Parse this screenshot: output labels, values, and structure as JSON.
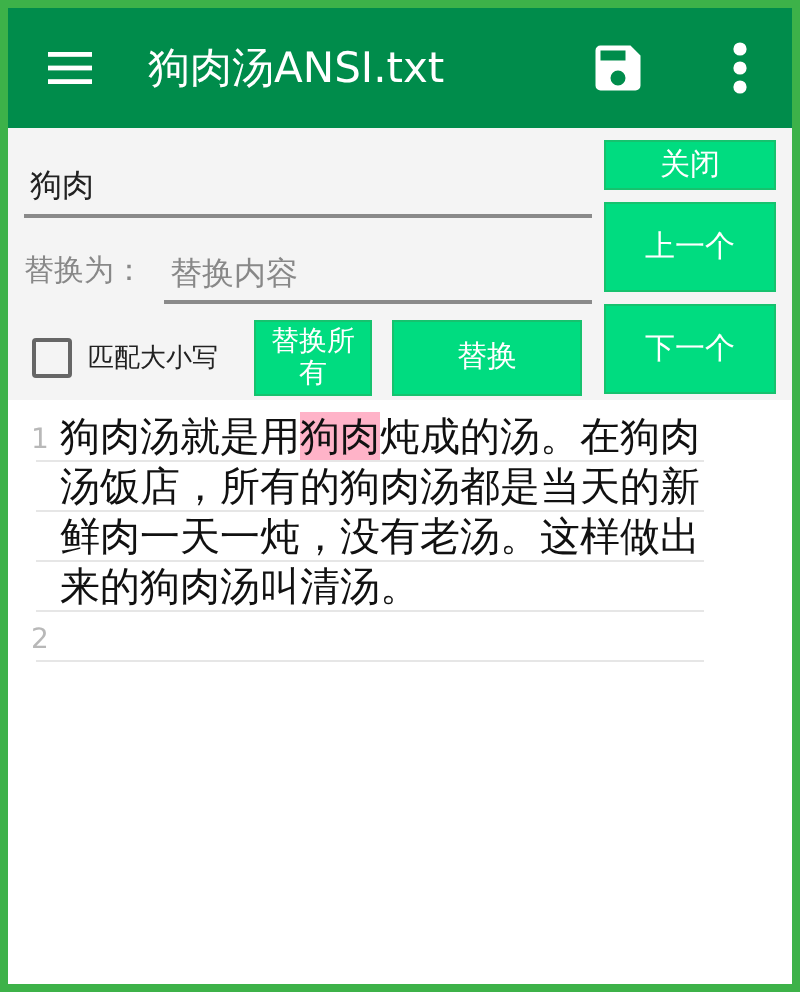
{
  "app_bar": {
    "title": "狗肉汤ANSI.txt"
  },
  "find_panel": {
    "search": {
      "value": "狗肉"
    },
    "replace": {
      "label": "替换为：",
      "placeholder": "替换内容"
    },
    "match_case": {
      "label": "匹配大小写",
      "checked": false
    },
    "buttons": [
      {
        "kind": "close",
        "label": "关闭"
      },
      {
        "kind": "previous",
        "label": "上一个"
      },
      {
        "kind": "replace_all",
        "label": "替换所有"
      },
      {
        "kind": "replace",
        "label": "替换"
      },
      {
        "kind": "next",
        "label": "下一个"
      }
    ]
  },
  "editor": {
    "lines": [
      {
        "number": "1",
        "segments": [
          {
            "text": "狗肉汤就是用",
            "highlighted": false
          },
          {
            "text": "狗肉",
            "highlighted": true
          },
          {
            "text": "炖成的汤。在狗肉汤饭店，所有的狗肉汤都是当天的新鲜肉一天一炖，没有老汤。这样做出来的狗肉汤叫清汤。",
            "highlighted": false
          }
        ]
      },
      {
        "number": "2"
      }
    ]
  }
}
